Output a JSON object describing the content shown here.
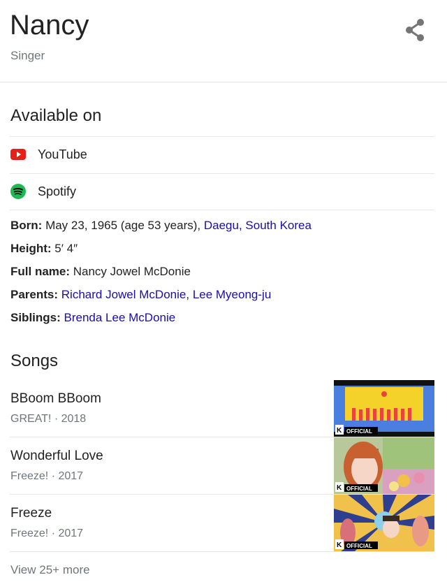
{
  "header": {
    "title": "Nancy",
    "subtitle": "Singer"
  },
  "available": {
    "title": "Available on",
    "services": [
      {
        "label": "YouTube",
        "icon": "youtube-icon",
        "color": "#e62117"
      },
      {
        "label": "Spotify",
        "icon": "spotify-icon",
        "color": "#1db954"
      }
    ]
  },
  "facts": {
    "born": {
      "label": "Born:",
      "value": "May 23, 1965 (age 53 years),",
      "link": "Daegu, South Korea"
    },
    "height": {
      "label": "Height:",
      "value": "5′ 4″"
    },
    "full_name": {
      "label": "Full name:",
      "value": "Nancy Jowel McDonie"
    },
    "parents": {
      "label": "Parents:",
      "link1": "Richard Jowel McDonie",
      "sep": ",",
      "link2": "Lee Myeong-ju"
    },
    "siblings": {
      "label": "Siblings:",
      "link": "Brenda Lee McDonie"
    }
  },
  "songs": {
    "title": "Songs",
    "items": [
      {
        "title": "BBoom BBoom",
        "meta": "GREAT! · 2018",
        "badge": "OFFICIAL"
      },
      {
        "title": "Wonderful Love",
        "meta": "Freeze! · 2017",
        "badge": "OFFICIAL"
      },
      {
        "title": "Freeze",
        "meta": "Freeze! · 2017",
        "badge": "OFFICIAL"
      }
    ],
    "more": "View 25+ more"
  },
  "colors": {
    "link": "#1a0dab",
    "muted": "#70757a"
  }
}
